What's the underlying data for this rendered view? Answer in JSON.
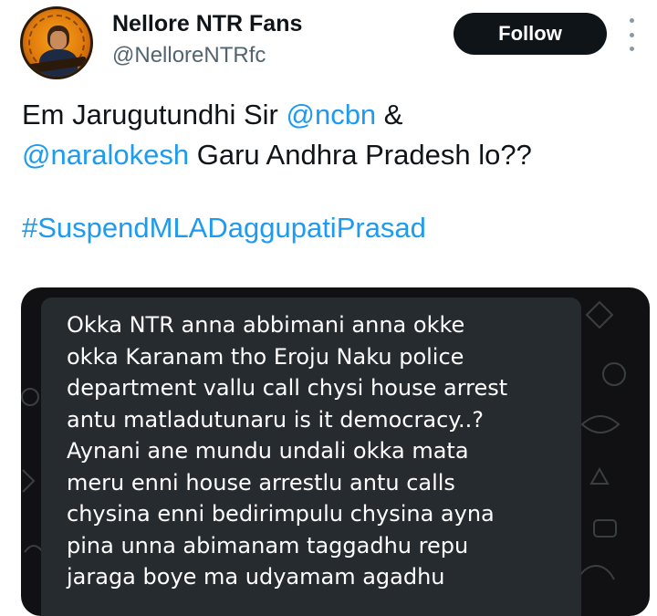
{
  "author": {
    "display_name": "Nellore NTR Fans",
    "handle": "@NelloreNTRfc",
    "avatar_icon": "profile-avatar-icon"
  },
  "follow_label": "Follow",
  "more_icon": "more-options-icon",
  "tweet": {
    "line1_text": "Em Jarugutundhi Sir ",
    "mention_1": "@ncbn",
    "line1_tail": " &",
    "mention_2": "@naralokesh",
    "line2_tail": " Garu Andhra Pradesh lo??",
    "hashtag": "#SuspendMLADaggupatiPrasad"
  },
  "media": {
    "message_lines": [
      "Okka NTR anna abbimani anna okke",
      "okka Karanam tho Eroju Naku police",
      "department vallu call chysi house arrest",
      "antu matladutunaru is it democracy..?",
      "Aynani ane mundu undali okka mata",
      "meru enni house arrestlu antu calls",
      "chysina enni bedirimpulu chysina ayna",
      "pina unna abimanam taggadhu repu",
      "jaraga boye ma udyamam agadhu"
    ]
  },
  "colors": {
    "text": "#0f1419",
    "secondary": "#536471",
    "link": "#1d9bf0",
    "button_bg": "#0f1419",
    "media_bg": "#111113",
    "bubble_bg": "#262b2f"
  }
}
